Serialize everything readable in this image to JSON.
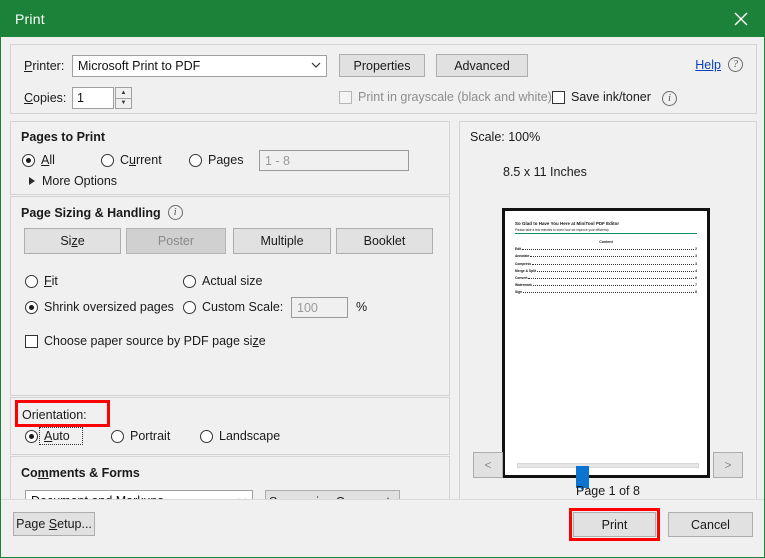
{
  "window": {
    "title": "Print",
    "close_icon": "close-icon",
    "accent_green": "#1c8239"
  },
  "printer": {
    "printer_label": "Printer:",
    "printer_value": "Microsoft Print to PDF",
    "properties_label": "Properties",
    "advanced_label": "Advanced",
    "help_label": "Help",
    "help_icon": "question-circle-icon",
    "copies_label": "Copies:",
    "copies_value": "1",
    "spinner_up": "▲",
    "spinner_down": "▼",
    "grayscale_label": "Print in grayscale (black and white)",
    "grayscale_checked": false,
    "grayscale_disabled": true,
    "save_ink_label": "Save ink/toner",
    "save_ink_checked": false,
    "info_icon": "info-circle-icon"
  },
  "pages_to_print": {
    "title": "Pages to Print",
    "options": [
      {
        "label": "All",
        "selected": true
      },
      {
        "label": "Current",
        "selected": false
      },
      {
        "label": "Pages",
        "selected": false
      }
    ],
    "range_placeholder": "1 - 8",
    "more_options_label": "More Options",
    "more_options_icon": "chevron-right-icon"
  },
  "page_sizing": {
    "title": "Page Sizing & Handling",
    "info_icon": "info-circle-icon",
    "mode_buttons": [
      {
        "label": "Size",
        "pressed": false
      },
      {
        "label": "Poster",
        "pressed": true
      },
      {
        "label": "Multiple",
        "pressed": false
      },
      {
        "label": "Booklet",
        "pressed": false
      }
    ],
    "scale_options": [
      {
        "label": "Fit",
        "selected": false
      },
      {
        "label": "Actual size",
        "selected": false
      },
      {
        "label": "Shrink oversized pages",
        "selected": true
      },
      {
        "label": "Custom Scale:",
        "selected": false
      }
    ],
    "custom_scale_value": "100",
    "percent_symbol": "%",
    "paper_source_label": "Choose paper source by PDF page size",
    "paper_source_checked": false
  },
  "orientation": {
    "title": "Orientation:",
    "highlighted": true,
    "highlight_color": "#ff0000",
    "options": [
      {
        "label": "Auto",
        "selected": true,
        "focused": true
      },
      {
        "label": "Portrait",
        "selected": false,
        "focused": false
      },
      {
        "label": "Landscape",
        "selected": false,
        "focused": false
      }
    ]
  },
  "comments_forms": {
    "title": "Comments & Forms",
    "selected_value": "Document and Markups",
    "summarize_label": "Summarize Comments"
  },
  "preview": {
    "scale_text": "Scale: 100%",
    "paper_size_text": "8.5 x 11 Inches",
    "page_indicator": "Page 1 of 8",
    "prev_label": "<",
    "next_label": ">",
    "prev_disabled": true,
    "next_disabled": true,
    "document": {
      "title": "So Glad to Have You Here at MiniTool PDF Editor",
      "subtitle": "Please take a few minutes to learn how we improve your efficiency",
      "rule_color": "#0f8a64",
      "toc_heading": "Content",
      "toc_entries": [
        {
          "label": "Edit",
          "page": "2"
        },
        {
          "label": "Annotate",
          "page": "3"
        },
        {
          "label": "Compress",
          "page": "3"
        },
        {
          "label": "Merge & Split",
          "page": "4"
        },
        {
          "label": "Convert",
          "page": "6"
        },
        {
          "label": "Watermark",
          "page": "7"
        },
        {
          "label": "Sign",
          "page": "8"
        }
      ]
    }
  },
  "footer": {
    "page_setup_label": "Page Setup...",
    "print_label": "Print",
    "cancel_label": "Cancel",
    "print_highlighted": true
  }
}
